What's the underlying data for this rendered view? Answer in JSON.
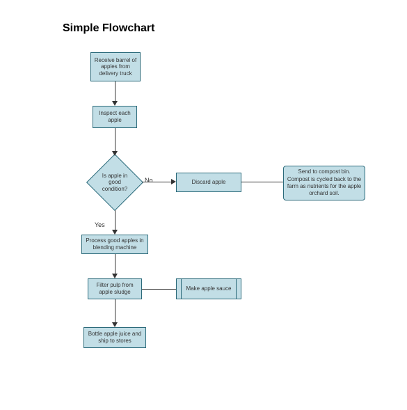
{
  "title": "Simple Flowchart",
  "nodes": {
    "receive": "Receive barrel of apples from delivery truck",
    "inspect": "Inspect each apple",
    "decision": "Is apple in good condition?",
    "discard": "Discard apple",
    "compost": "Send to compost bin. Compost is cycled back to the farm as nutrients for the apple orchard soil.",
    "process": "Process good apples in blending machine",
    "filter": "Filter pulp from apple sludge",
    "sauce": "Make apple sauce",
    "bottle": "Bottle apple juice and ship to stores"
  },
  "labels": {
    "yes": "Yes",
    "no": "No"
  }
}
